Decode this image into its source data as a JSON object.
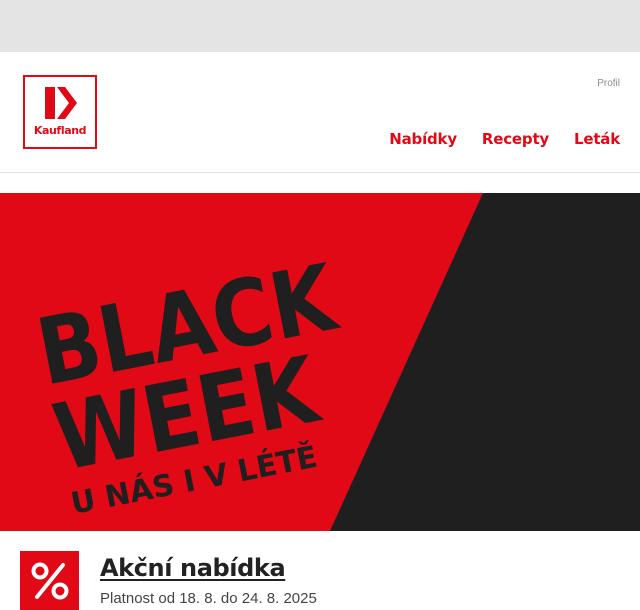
{
  "header": {
    "logo_text": "Kaufland",
    "profile_label": "Profil",
    "nav": [
      {
        "label": "Nabídky"
      },
      {
        "label": "Recepty"
      },
      {
        "label": "Leták"
      }
    ]
  },
  "banner": {
    "line1": "BLACK",
    "line2": "WEEK",
    "line3": "U NÁS I V LÉTĚ"
  },
  "offer": {
    "title": "Akční nabídka",
    "validity": "Platnost od 18. 8. do 24. 8. 2025",
    "icon": "percent-icon"
  },
  "colors": {
    "brand_red": "#e10915",
    "banner_dark": "#1f1f1f",
    "top_strip": "#e4e4e4"
  }
}
